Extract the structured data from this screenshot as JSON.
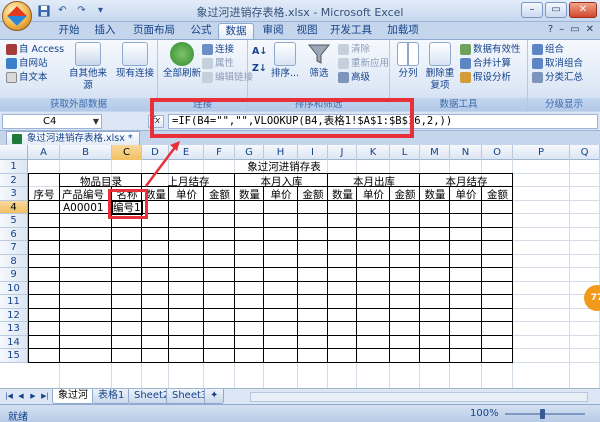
{
  "window": {
    "title": "象过河进销存表格.xlsx - Microsoft Excel",
    "controls": [
      "–",
      "▭",
      "✕"
    ]
  },
  "qat": [
    "save-icon",
    "undo-icon",
    "redo-icon",
    "dropdown-icon"
  ],
  "tabs": [
    "开始",
    "插入",
    "页面布局",
    "公式",
    "数据",
    "审阅",
    "视图",
    "开发工具",
    "加载项"
  ],
  "active_tab": "数据",
  "ribbon": {
    "groups": {
      "external": {
        "label": "获取外部数据",
        "from_access": "自 Access",
        "from_web": "自网站",
        "from_text": "自文本",
        "other_sources": "自其他来源",
        "existing_connections": "现有连接"
      },
      "connections": {
        "label": "连接",
        "refresh_all": "全部刷新",
        "connections": "连接",
        "properties": "属性",
        "edit_links": "编辑链接"
      },
      "sort_filter": {
        "label": "排序和筛选",
        "sort": "排序...",
        "filter": "筛选",
        "clear": "清除",
        "reapply": "重新应用",
        "advanced": "高级"
      },
      "data_tools": {
        "label": "数据工具",
        "text_to_columns": "分列",
        "remove_duplicates": "删除重复项",
        "data_validation": "数据有效性",
        "consolidate": "合并计算",
        "what_if": "假设分析"
      },
      "outline": {
        "label": "分级显示",
        "group": "组合",
        "ungroup": "取消组合",
        "subtotal": "分类汇总"
      }
    }
  },
  "formula_bar": {
    "name_box": "C4",
    "fx": "fx",
    "formula": "=IF(B4=\"\",\"\",VLOOKUP(B4,表格1!$A$1:$B$16,2,))"
  },
  "workbook_tab": "象过河进销存表格.xlsx *",
  "grid": {
    "columns": [
      "A",
      "B",
      "C",
      "D",
      "E",
      "F",
      "G",
      "H",
      "I",
      "J",
      "K",
      "L",
      "M",
      "N",
      "O",
      "P",
      "Q"
    ],
    "rows": [
      "1",
      "2",
      "3",
      "4",
      "5",
      "6",
      "7",
      "8",
      "9",
      "10",
      "11",
      "12",
      "13",
      "14",
      "15"
    ],
    "selected_column": "C",
    "selected_row": "4",
    "cells": {
      "title": "象过河进销存表",
      "group_product": "物品目录",
      "group_opening": "上月结存",
      "group_in": "本月入库",
      "group_out": "本月出库",
      "group_closing": "本月结存",
      "h_seq": "序号",
      "h_code": "产品编号",
      "h_name": "名称",
      "h_qty": "数量",
      "h_price": "单价",
      "h_amount": "金额",
      "b4": "A00001",
      "c4": "编号1"
    }
  },
  "sheets": [
    "象过河",
    "表格1",
    "Sheet2",
    "Sheet3"
  ],
  "active_sheet": "象过河",
  "status": {
    "ready": "就绪",
    "zoom": "100%"
  },
  "side_badge": "77"
}
